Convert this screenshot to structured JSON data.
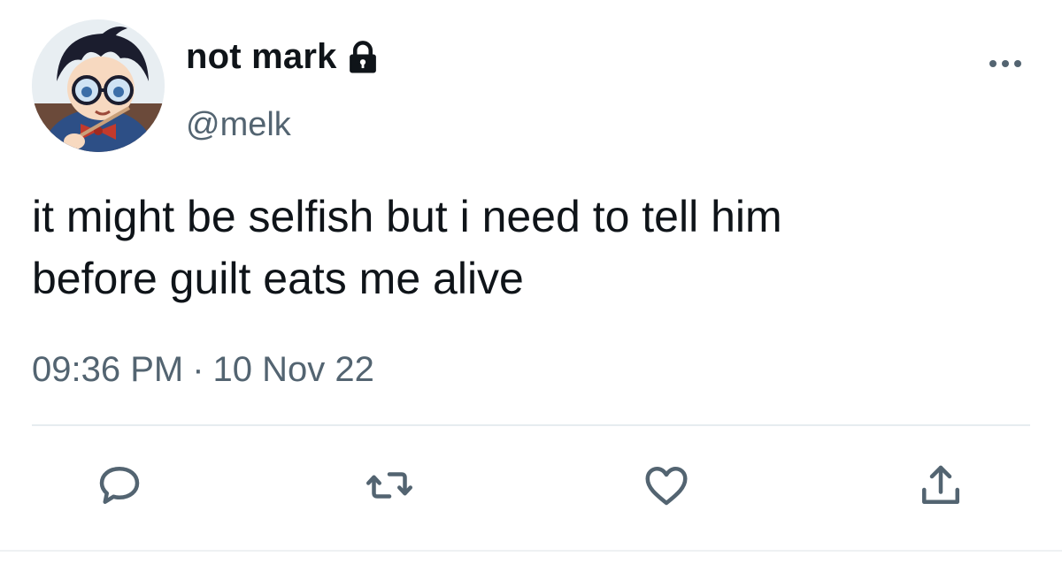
{
  "tweet": {
    "display_name": "not mark",
    "handle": "@melk",
    "text": "it might be selfish but i need to tell him\nbefore guilt eats me alive",
    "time": "09:36 PM",
    "separator": "·",
    "date": "10 Nov 22"
  },
  "icons": {
    "lock": "lock-icon",
    "more": "more-horizontal-icon",
    "reply": "reply-bubble-icon",
    "retweet": "retweet-icon",
    "like": "heart-icon",
    "share": "share-upload-icon"
  },
  "colors": {
    "primary_text": "#0f1419",
    "secondary_text": "#536471",
    "divider": "#e6ecf0"
  }
}
